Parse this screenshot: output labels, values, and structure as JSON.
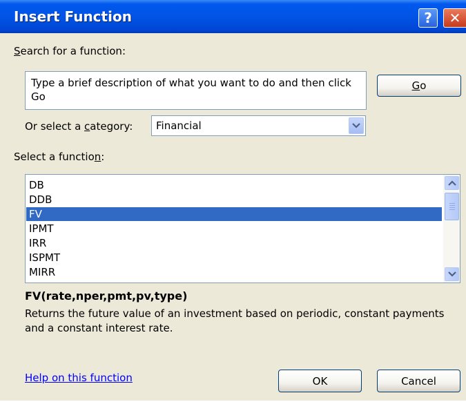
{
  "window": {
    "title": "Insert Function",
    "help_glyph": "?",
    "close_glyph": "✕"
  },
  "search": {
    "label_pre": "",
    "label_hotkey": "S",
    "label_post": "earch for a function:",
    "value": "Type a brief description of what you want to do and then click Go",
    "go_pre": "",
    "go_hotkey": "G",
    "go_post": "o"
  },
  "category": {
    "label_pre": "Or select a ",
    "label_hotkey": "c",
    "label_post": "ategory:",
    "selected": "Financial"
  },
  "function_list": {
    "label_pre": "Select a functio",
    "label_hotkey": "n",
    "label_post": ":",
    "items": [
      "DB",
      "DDB",
      "FV",
      "IPMT",
      "IRR",
      "ISPMT",
      "MIRR"
    ],
    "selected": "FV"
  },
  "details": {
    "syntax": "FV(rate,nper,pmt,pv,type)",
    "description": "Returns the future value of an investment based on periodic, constant payments and a constant interest rate."
  },
  "footer": {
    "help_link": "Help on this function",
    "ok_label": "OK",
    "cancel_label": "Cancel"
  },
  "colors": {
    "titlebar": "#0054e3",
    "dialog_bg": "#ece9d8",
    "selection": "#316ac5",
    "link": "#0000ff"
  }
}
